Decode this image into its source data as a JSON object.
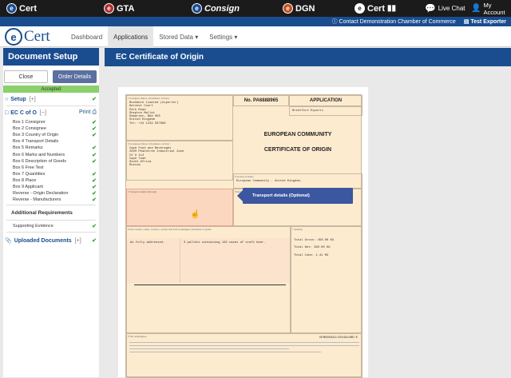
{
  "topbar": {
    "apps": [
      "Cert",
      "GTA",
      "Consign",
      "DGN"
    ],
    "brand_logo": "Cert",
    "live_chat": "Live Chat",
    "my_account": "My Account",
    "icons": [
      "ecert-logo-icon",
      "chat-icon",
      "user-icon"
    ]
  },
  "subbar": {
    "contact": "Contact Demonstration Chamber of Commerce",
    "user": "Test Exporter"
  },
  "nav": {
    "brand": "Cert",
    "items": [
      "Dashboard",
      "Applications",
      "Stored Data",
      "Settings"
    ],
    "active": "Applications"
  },
  "sidebar": {
    "title": "Document Setup",
    "close_label": "Close",
    "order_label": "Order Details",
    "status": "Accepted",
    "setup_label": "Setup",
    "setup_toggle": "[+]",
    "ecoo_label": "EC C of O",
    "ecoo_toggle": "[−]",
    "print_label": "Print",
    "items": [
      {
        "label": "Box 1 Consignor",
        "done": true
      },
      {
        "label": "Box 2 Consignee",
        "done": true
      },
      {
        "label": "Box 3 Country of Origin",
        "done": true
      },
      {
        "label": "Box 4 Transport Details",
        "done": false
      },
      {
        "label": "Box 5 Remarks",
        "done": true
      },
      {
        "label": "Box 6 Marks and Numbers",
        "done": true
      },
      {
        "label": "Box 6 Description of Goods",
        "done": true
      },
      {
        "label": "Box 6 Free Text",
        "done": false
      },
      {
        "label": "Box 7 Quantities",
        "done": true
      },
      {
        "label": "Box 8 Place",
        "done": true
      },
      {
        "label": "Box 9 Applicant",
        "done": true
      },
      {
        "label": "Reverse - Origin Declaration",
        "done": true
      },
      {
        "label": "Reverse - Manufacturers",
        "done": true
      }
    ],
    "additional_title": "Additional Requirements",
    "supporting_label": "Supporting Evidence",
    "uploaded_label": "Uploaded Documents",
    "uploaded_toggle": "[+]"
  },
  "main": {
    "title": "EC Certificate of Origin"
  },
  "certificate": {
    "consignor_label": "1 Consignor (Name, full address, country)",
    "consignor": [
      "Rushmore Limited (exporter)",
      "Harvest Court",
      "Park Road",
      "Shepton Mallet",
      "Somerset, BA4 5HS",
      "United Kingdom",
      "Tel: +44 1234 567890"
    ],
    "number": "No. PA6888965",
    "application": "APPLICATION",
    "exporter": "Brentford Exports",
    "consignee_label": "2 Consignee (Name, full address, country)",
    "consignee": [
      "Cape Food and Beverages",
      "2020 Peachtree Industrial Zone",
      "CV # 114",
      "Cape Town",
      "South Africa",
      "Russia"
    ],
    "title1": "EUROPEAN COMMUNITY",
    "title2": "CERTIFICATE OF ORIGIN",
    "origin_label": "3 Country of Origin",
    "origin": "European Community - United Kingdom.",
    "transport_label": "4 Transport details (Optional)",
    "remarks_label": "5 Remarks",
    "goods_label": "6 Item number; marks, numbers, number and kind of packages; description of goods",
    "marks": "As fully addressed.",
    "description": "3 pallets containing 120 cases of craft beer.",
    "quantity_label": "7 Quantity",
    "gross": "Total Gross: 450.00 KG",
    "net": "Total Net: 390.00 KG",
    "cube": "Total Cube: 1.41 M3",
    "applicant_label": "9 The undersigned",
    "ref": "DEMO00929/2024844RE/E",
    "tooltip": "Transport details (Optional)"
  }
}
